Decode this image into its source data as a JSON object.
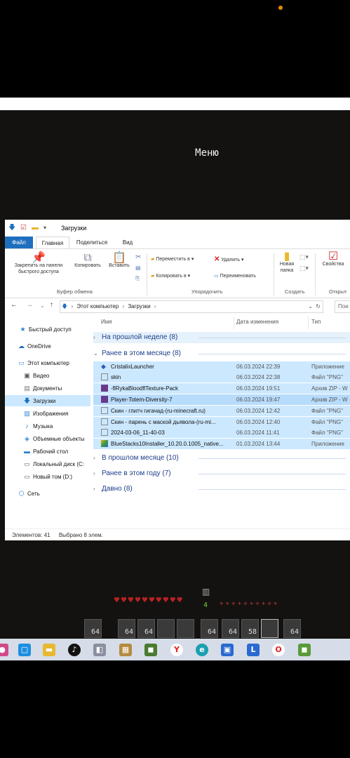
{
  "game": {
    "menu_title": "Меню"
  },
  "window": {
    "title": "Загрузки",
    "tabs": [
      "Файл",
      "Главная",
      "Поделиться",
      "Вид"
    ],
    "ribbon": {
      "pin_label": "Закрепить на панели быстрого доступа",
      "copy_label": "Копировать",
      "paste_label": "Вставить",
      "clipboard_group": "Буфер обмена",
      "move_to_label": "Переместить в",
      "copy_to_label": "Копировать в",
      "delete_label": "Удалить",
      "rename_label": "Переименовать",
      "organize_group": "Упорядочить",
      "new_folder_label": "Новая папка",
      "create_group": "Создать",
      "properties_label": "Свойства",
      "open_group": "Открыт"
    },
    "address": {
      "path": [
        "Этот компьютер",
        "Загрузки"
      ],
      "search_placeholder": "Пои"
    },
    "nav": [
      {
        "label": "Быстрый доступ",
        "icon": "star-icon"
      },
      {
        "label": "OneDrive",
        "icon": "cloud-icon"
      },
      {
        "label": "Этот компьютер",
        "icon": "computer-icon"
      },
      {
        "label": "Видео",
        "icon": "video-icon"
      },
      {
        "label": "Документы",
        "icon": "document-icon"
      },
      {
        "label": "Загрузки",
        "icon": "download-icon"
      },
      {
        "label": "Изображения",
        "icon": "image-icon"
      },
      {
        "label": "Музыка",
        "icon": "music-icon"
      },
      {
        "label": "Объемные объекты",
        "icon": "cube-icon"
      },
      {
        "label": "Рабочий стол",
        "icon": "desktop-icon"
      },
      {
        "label": "Локальный диск (C:",
        "icon": "disk-icon"
      },
      {
        "label": "Новый том (D:)",
        "icon": "disk-icon"
      },
      {
        "label": "Сеть",
        "icon": "network-icon"
      }
    ],
    "columns": {
      "name": "Имя",
      "date": "Дата изменения",
      "type": "Тип"
    },
    "groups": {
      "last_week": "На прошлой неделе (8)",
      "this_month": "Ранее в этом месяце (8)",
      "last_month": "В прошлом месяце (10)",
      "this_year": "Ранее в этом году (7)",
      "long_ago": "Давно (8)"
    },
    "files": [
      {
        "name": "CristalixLauncher",
        "date": "06.03.2024 22:39",
        "type": "Приложение"
      },
      {
        "name": "skin",
        "date": "06.03.2024 22:38",
        "type": "Файл \"PNG\""
      },
      {
        "name": "-flRykaBloodflTexture-Pack",
        "date": "06.03.2024 19:51",
        "type": "Архив ZIP - W"
      },
      {
        "name": "Player-Totem-Diversity-7",
        "date": "06.03.2024 19:47",
        "type": "Архив ZIP - W"
      },
      {
        "name": "Скин - глитч гигачад-(ru-minecraft.ru)",
        "date": "06.03.2024 12:42",
        "type": "Файл \"PNG\""
      },
      {
        "name": "Скин - парень с маской дьявола-(ru-mi...",
        "date": "06.03.2024 12:40",
        "type": "Файл \"PNG\""
      },
      {
        "name": "2024-03-06_11-40-03",
        "date": "06.03.2024 11:41",
        "type": "Файл \"PNG\""
      },
      {
        "name": "BlueStacks10Installer_10.20.0.1005_native...",
        "date": "01.03.2024 13:44",
        "type": "Приложение"
      }
    ],
    "status": {
      "count": "Элементов: 41",
      "selected": "Выбрано 8 элем."
    }
  },
  "hud": {
    "xp_level": "4",
    "slots": [
      "64",
      "64",
      "64",
      "",
      "",
      "64",
      "64",
      "58",
      "",
      "64"
    ]
  }
}
